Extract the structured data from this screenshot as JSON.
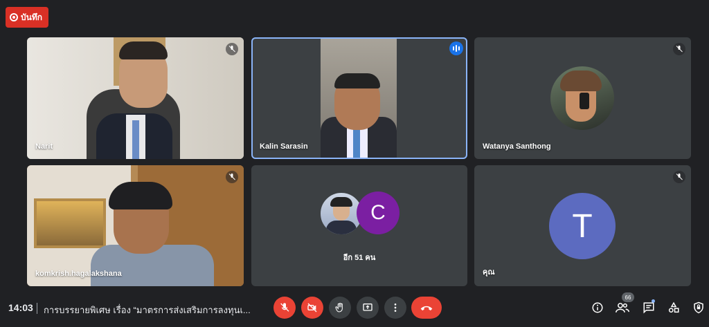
{
  "record": {
    "label": "บันทึก"
  },
  "tiles": [
    {
      "name": "Narit",
      "muted": true
    },
    {
      "name": "Kalin Sarasin",
      "speaking": true
    },
    {
      "name": "Watanya Santhong",
      "muted": true
    },
    {
      "name": "komkrish.hagalakshana",
      "muted": true
    },
    {
      "others_label": "อีก 51 คน",
      "avatar_letter": "C"
    },
    {
      "name": "คุณ",
      "avatar_letter": "T",
      "muted": true
    }
  ],
  "footer": {
    "time": "14:03",
    "meeting_title": "การบรรยายพิเศษ เรื่อง “มาตรการส่งเสริมการลงทุนเ..."
  },
  "participants_count": "66",
  "colors": {
    "background": "#202124",
    "tile": "#3c4043",
    "accent_blue": "#1a73e8",
    "red": "#ea4335",
    "avatar_c": "#7b1fa2",
    "avatar_t": "#5c6bc0"
  },
  "icons": [
    "record-icon",
    "mic-off-icon",
    "speaking-icon",
    "camera-off-icon",
    "raise-hand-icon",
    "present-icon",
    "more-options-icon",
    "end-call-icon",
    "info-icon",
    "people-icon",
    "chat-icon",
    "activities-icon",
    "host-controls-icon"
  ]
}
